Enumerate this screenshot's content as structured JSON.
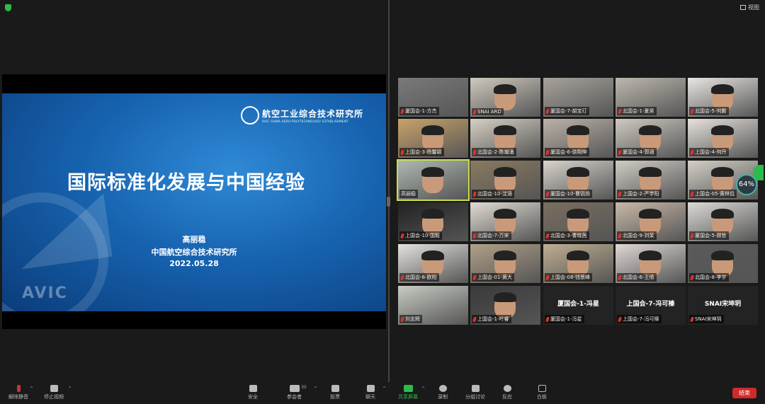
{
  "header": {
    "view_label": "视图"
  },
  "slide": {
    "org_name": "航空工业综合技术研究所",
    "org_name_en": "AVIC CHINA AERO-POLYTECHNOLOGY ESTABLISHMENT",
    "title": "国际标准化发展与中国经验",
    "speaker": "高丽稳",
    "speaker_org": "中国航空综合技术研究所",
    "date": "2022.05.28",
    "watermark": "AVIC"
  },
  "network_stats": {
    "percent": "64%"
  },
  "participants": [
    {
      "name": "厦国会-1-方杰"
    },
    {
      "name": "SNAI ARD"
    },
    {
      "name": "厦国会-7-胡宝玎"
    },
    {
      "name": "北国会-1-夏昊"
    },
    {
      "name": "北国会-5-何鹏"
    },
    {
      "name": "上国会-3-杨馨颖"
    },
    {
      "name": "北国会-2-陈瀚涌"
    },
    {
      "name": "厦国会-6-徐翔伸"
    },
    {
      "name": "厦国会-4-郭涵"
    },
    {
      "name": "上国会-4-何丹"
    },
    {
      "name": "高丽稳"
    },
    {
      "name": "北国会-10-沈涵"
    },
    {
      "name": "厦国会-10-曹锐扬"
    },
    {
      "name": "上国会-2-严学阳"
    },
    {
      "name": "上国会-05-黄林侃"
    },
    {
      "name": "上国会-10-国毅"
    },
    {
      "name": "北国会-7-万宋"
    },
    {
      "name": "北国会-3-曹晓茜"
    },
    {
      "name": "北国会-9-刘茉"
    },
    {
      "name": "厦国会-5-顾哲"
    },
    {
      "name": "北国会-8-欧阳"
    },
    {
      "name": "上国会-01-黄大"
    },
    {
      "name": "上国会-08-钱景峰"
    },
    {
      "name": "北国会-6-王倩"
    },
    {
      "name": "北国会-8-李宇"
    },
    {
      "name": "刘志辉"
    },
    {
      "name": "上国会-1-叶睿"
    },
    {
      "name": "厦国会-1-冯星",
      "display": "厦国会-1-冯星"
    },
    {
      "name": "上国会-7-冯可榛",
      "display": "上国会-7-冯可榛"
    },
    {
      "name": "SNAI宋坤玥",
      "display": "SNAI宋坤玥"
    }
  ],
  "toolbar": {
    "unmute": "解除静音",
    "stop_video": "停止视频",
    "security": "安全",
    "participants": "参会者",
    "participants_count": "30",
    "polls": "投票",
    "chat": "聊天",
    "share_screen": "共享屏幕",
    "record": "录制",
    "breakout": "分组讨论",
    "reactions": "反应",
    "whiteboard": "白板",
    "end": "结束"
  }
}
